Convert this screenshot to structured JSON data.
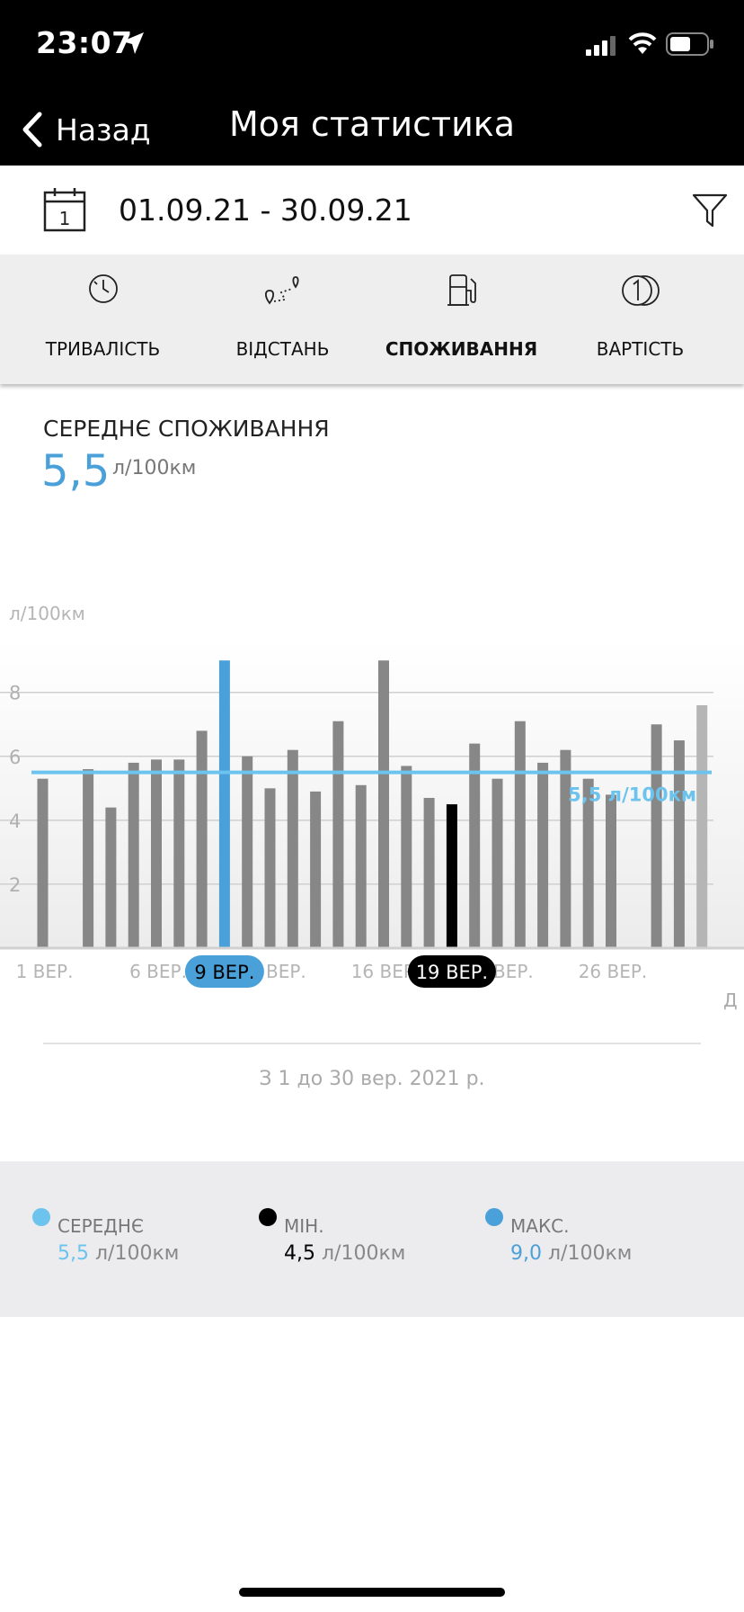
{
  "status_bar": {
    "time": "23:07"
  },
  "header": {
    "back_label": "Назад",
    "title": "Моя статистика"
  },
  "date_filter": {
    "calendar_day": "1",
    "range": "01.09.21 - 30.09.21"
  },
  "tabs": [
    {
      "label": "ТРИВАЛІСТЬ",
      "icon": "clock-icon",
      "active": false
    },
    {
      "label": "ВІДСТАНЬ",
      "icon": "route-icon",
      "active": false
    },
    {
      "label": "СПОЖИВАННЯ",
      "icon": "fuel-pump-icon",
      "active": true
    },
    {
      "label": "ВАРТІСТЬ",
      "icon": "coin-icon",
      "active": false
    }
  ],
  "summary": {
    "title": "СЕРЕДНЄ СПОЖИВАННЯ",
    "value": "5,5",
    "unit": "л/100км"
  },
  "chart_data": {
    "type": "bar",
    "y_unit": "л/100км",
    "ylim": [
      0,
      9.4
    ],
    "y_ticks": [
      "2",
      "4",
      "6",
      "8"
    ],
    "grid": true,
    "x": [
      1,
      2,
      3,
      4,
      5,
      6,
      7,
      8,
      9,
      10,
      11,
      12,
      13,
      14,
      15,
      16,
      17,
      18,
      19,
      20,
      21,
      22,
      23,
      24,
      25,
      26,
      27,
      28,
      29,
      30
    ],
    "values": [
      5.3,
      0,
      5.6,
      4.4,
      5.8,
      5.9,
      5.9,
      6.8,
      9.0,
      6.0,
      5.0,
      6.2,
      4.9,
      7.1,
      5.1,
      9.0,
      5.7,
      4.7,
      4.5,
      6.4,
      5.3,
      7.1,
      5.8,
      6.2,
      5.3,
      4.8,
      0,
      7.0,
      6.5,
      7.6
    ],
    "x_tick_labels": [
      {
        "day": 1,
        "label": "1 ВЕР."
      },
      {
        "day": 6,
        "label": "6 ВЕР."
      },
      {
        "day": 11,
        "label": "11 ВЕР."
      },
      {
        "day": 16,
        "label": "16 ВЕР."
      },
      {
        "day": 21,
        "label": "21 ВЕР."
      },
      {
        "day": 26,
        "label": "26 ВЕР."
      }
    ],
    "average_line": {
      "value": 5.5,
      "label": "5,5 л/100км",
      "color": "#6cc4ee"
    },
    "highlight_max": {
      "day": 9,
      "label": "9 ВЕР.",
      "color": "#4aa0d8"
    },
    "highlight_min": {
      "day": 19,
      "label": "19 ВЕР.",
      "color": "#000000"
    },
    "bar_color": "#878787",
    "last_bar_color": "#b5b5b5",
    "cut_label": "Д"
  },
  "period_text": "З 1 до 30 вер. 2021 р.",
  "legend": [
    {
      "name": "СЕРЕДНЄ",
      "value": "5,5",
      "unit": "л/100км",
      "dot_color": "#6cc4ee",
      "value_color": "#6cc4ee"
    },
    {
      "name": "МІН.",
      "value": "4,5",
      "unit": "л/100км",
      "dot_color": "#000000",
      "value_color": "#000000"
    },
    {
      "name": "МАКС.",
      "value": "9,0",
      "unit": "л/100км",
      "dot_color": "#4aa0d8",
      "value_color": "#4aa0d8"
    }
  ],
  "colors": {
    "accent": "#4aa0d8",
    "average": "#6cc4ee",
    "header_bg": "#000000"
  }
}
